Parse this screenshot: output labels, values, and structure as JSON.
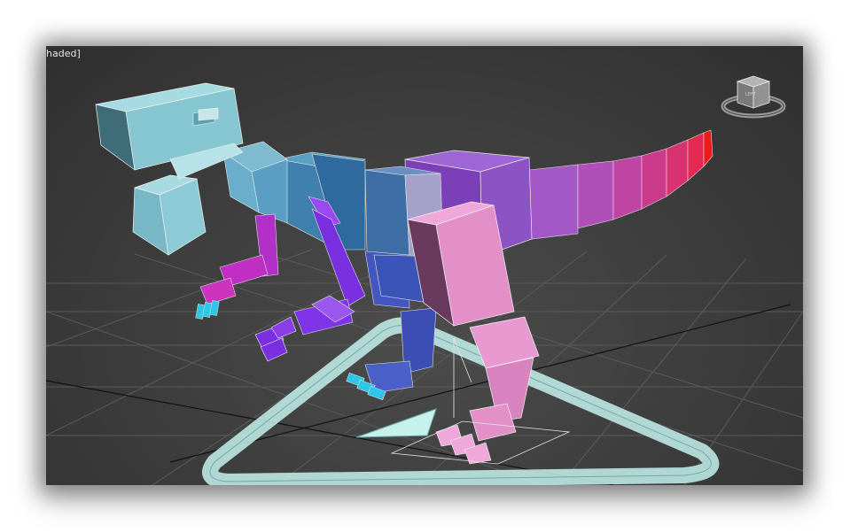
{
  "viewport": {
    "label": "haded]",
    "view_cube_face": "LEFT",
    "colors": {
      "background": "#3f3f3f",
      "grid": "#5a5a5a",
      "head": "#86c6d0",
      "neck": "#4e8bb5",
      "body_front": "#3d6fa6",
      "pelvis": "#8c53c4",
      "tail_start": "#9e4fc0",
      "tail_end": "#ee1a1a",
      "arm_near": "#7a2fe0",
      "arm_far": "#b030c8",
      "leg_near": "#e38fc8",
      "leg_far": "#4a60c8",
      "hand_tip": "#2ec6e8",
      "ik_control": "#c6f2ee"
    }
  }
}
